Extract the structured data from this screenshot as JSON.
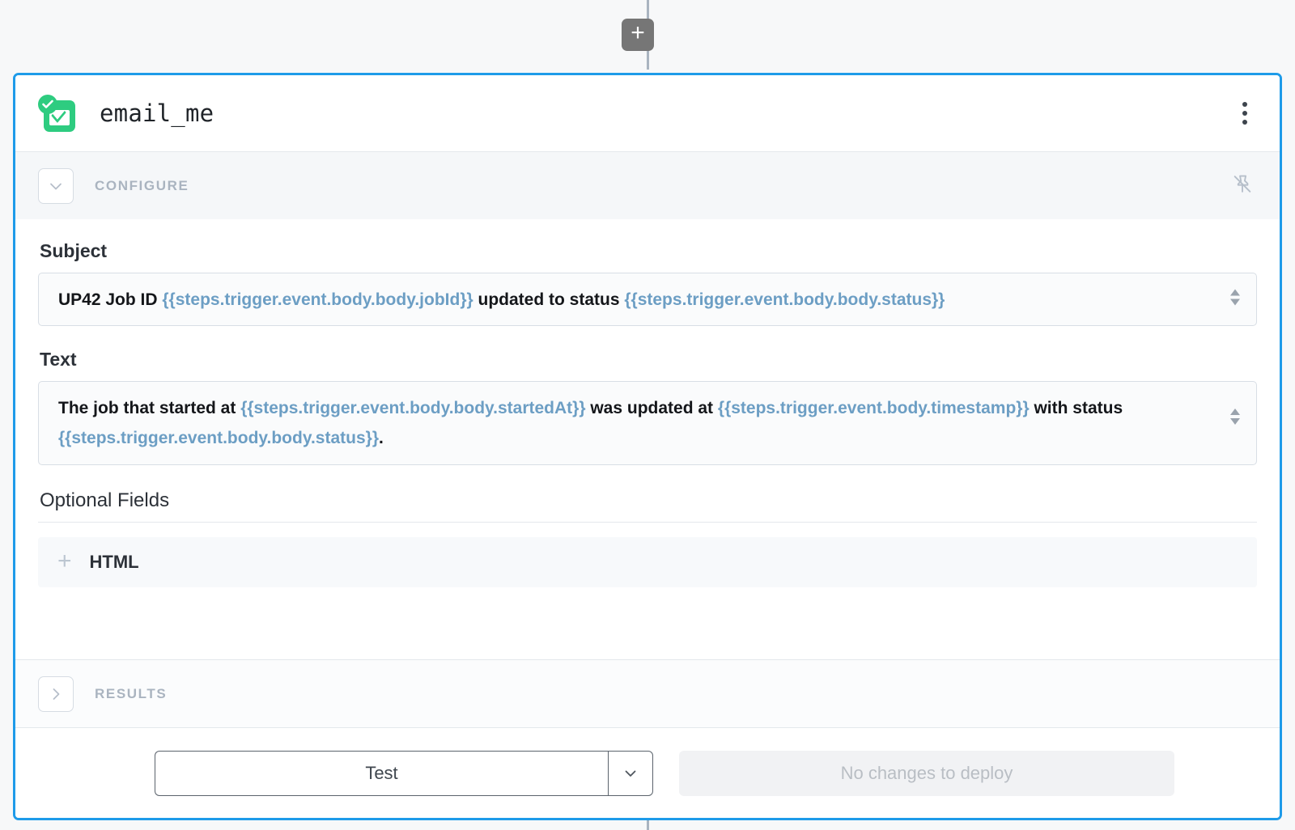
{
  "canvas": {
    "add_step_button_label": "+",
    "add_step_icon": "plus-icon"
  },
  "card": {
    "accent_color": "#1e9be9",
    "header": {
      "step_title": "email_me",
      "app_icon": "email-check-icon",
      "status_badge_icon": "check-circle-icon",
      "menu_icon": "kebab-menu-icon"
    },
    "configure_section": {
      "label": "CONFIGURE",
      "toggle_icon": "chevron-down-icon",
      "pin_icon": "pin-off-icon",
      "expanded": true
    },
    "results_section": {
      "label": "RESULTS",
      "toggle_icon": "chevron-right-icon",
      "expanded": false
    },
    "fields": {
      "subject": {
        "label": "Subject",
        "value_parts": [
          {
            "type": "text",
            "text": "UP42 Job ID "
          },
          {
            "type": "template",
            "text": "{{steps.trigger.event.body.body.jobId}}"
          },
          {
            "type": "text",
            "text": " updated to status "
          },
          {
            "type": "template",
            "text": "{{steps.trigger.event.body.body.status}}"
          }
        ],
        "expand_icon": "expand-collapse-icon"
      },
      "text": {
        "label": "Text",
        "value_parts": [
          {
            "type": "text",
            "text": "The job that started at "
          },
          {
            "type": "template",
            "text": "{{steps.trigger.event.body.body.startedAt}}"
          },
          {
            "type": "text",
            "text": " was updated at "
          },
          {
            "type": "template",
            "text": "{{steps.trigger.event.body.timestamp}}"
          },
          {
            "type": "text",
            "text": " with status "
          },
          {
            "type": "template",
            "text": "{{steps.trigger.event.body.body.status}}"
          },
          {
            "type": "text",
            "text": "."
          }
        ],
        "expand_icon": "expand-collapse-icon"
      }
    },
    "optional_fields": {
      "title": "Optional Fields",
      "rows": [
        {
          "label": "HTML",
          "icon": "plus-icon"
        }
      ]
    },
    "footer": {
      "test_label": "Test",
      "test_caret_icon": "chevron-down-icon",
      "deploy_label": "No changes to deploy",
      "deploy_disabled": true
    }
  },
  "colors": {
    "accent": "#1e9be9",
    "template_token": "#6c9ec4",
    "icon_green": "#2ecc80",
    "muted_label": "#aab4c0"
  }
}
